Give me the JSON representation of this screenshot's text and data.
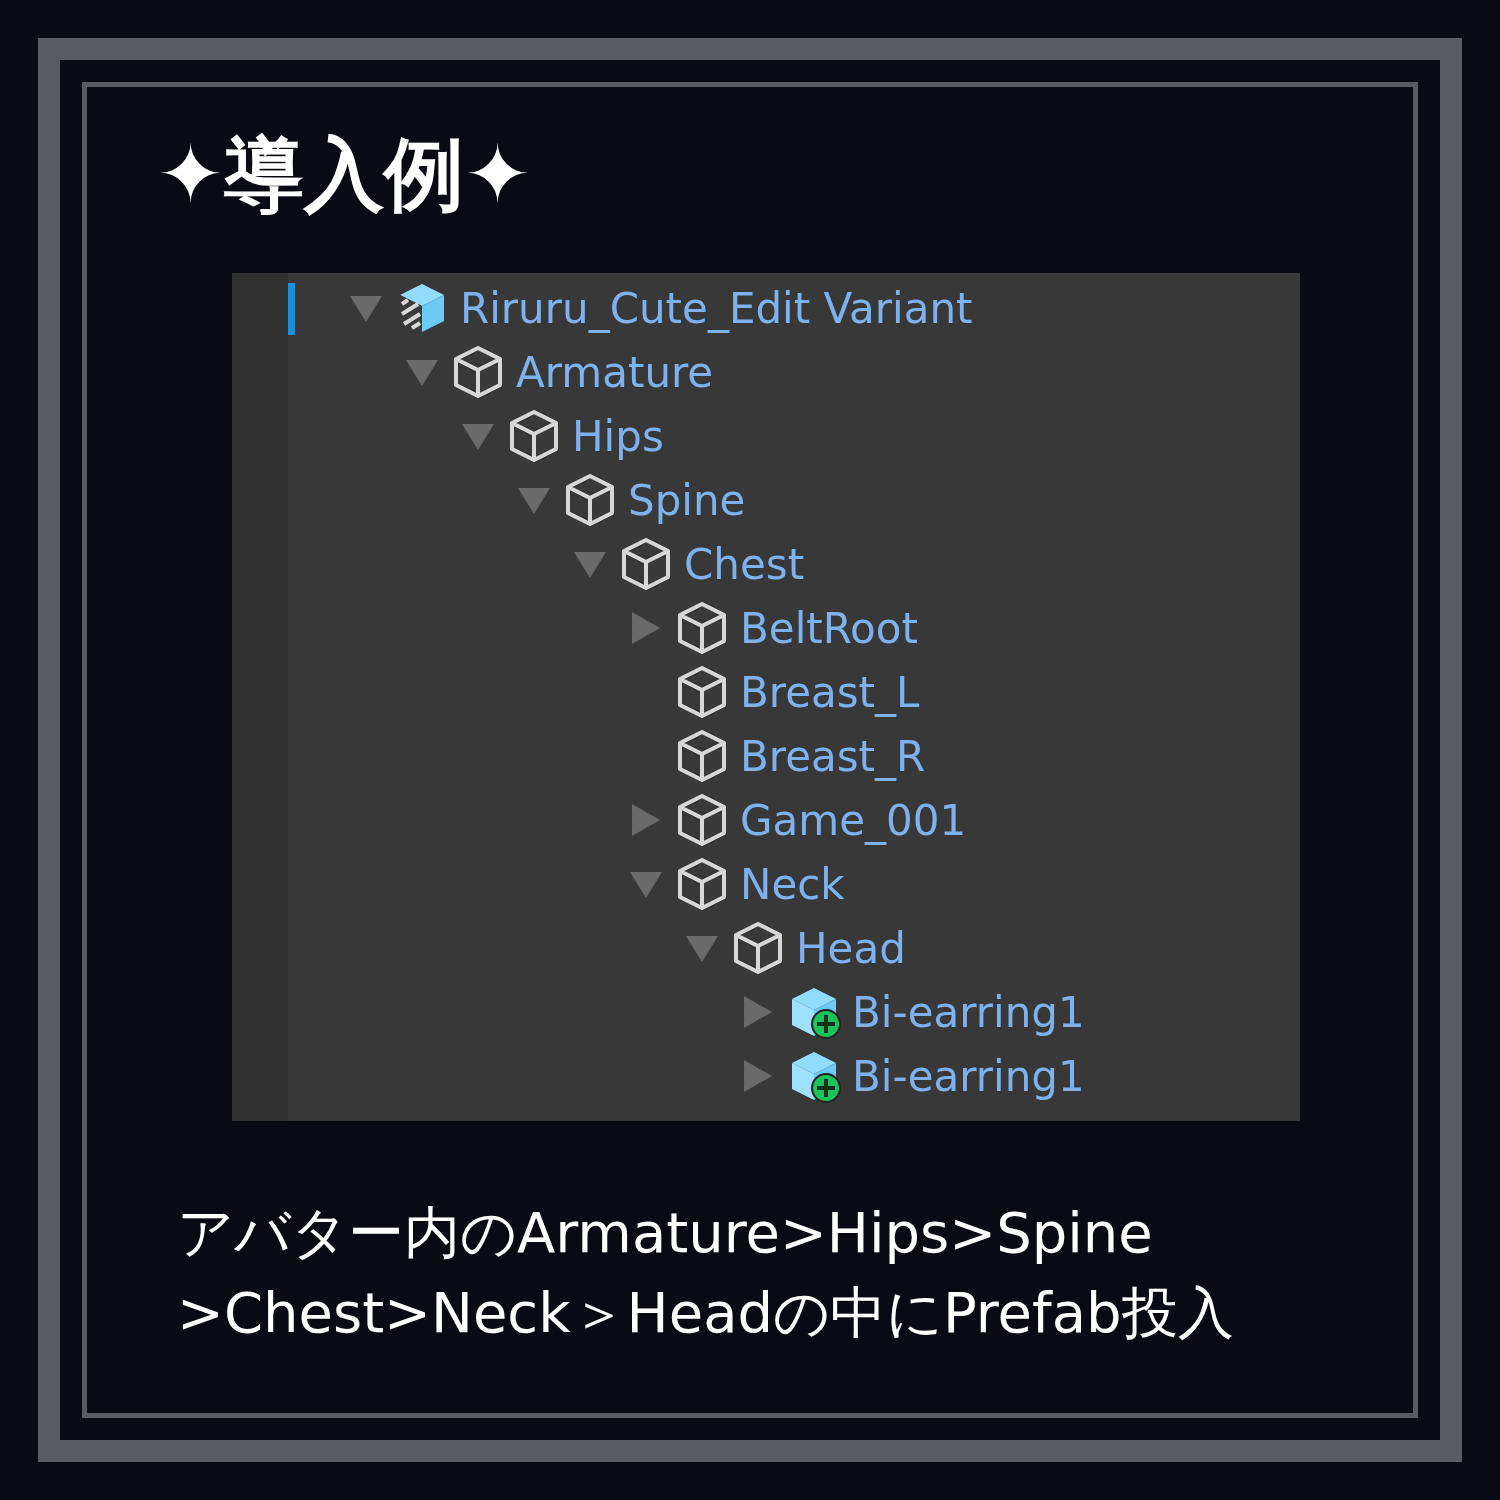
{
  "title": "✦導入例✦",
  "hierarchy": {
    "items": [
      {
        "label": "Riruru_Cute_Edit Variant",
        "kind": "prefab-root",
        "expanded": true,
        "selected": true,
        "children": [
          {
            "label": "Armature",
            "kind": "object",
            "expanded": true,
            "children": [
              {
                "label": "Hips",
                "kind": "object",
                "expanded": true,
                "children": [
                  {
                    "label": "Spine",
                    "kind": "object",
                    "expanded": true,
                    "children": [
                      {
                        "label": "Chest",
                        "kind": "object",
                        "expanded": true,
                        "children": [
                          {
                            "label": "BeltRoot",
                            "kind": "object",
                            "expanded": false
                          },
                          {
                            "label": "Breast_L",
                            "kind": "object"
                          },
                          {
                            "label": "Breast_R",
                            "kind": "object"
                          },
                          {
                            "label": "Game_001",
                            "kind": "object",
                            "expanded": false
                          },
                          {
                            "label": "Neck",
                            "kind": "object",
                            "expanded": true,
                            "children": [
                              {
                                "label": "Head",
                                "kind": "object",
                                "expanded": true,
                                "children": [
                                  {
                                    "label": "Bi-earring1",
                                    "kind": "added-prefab",
                                    "expanded": false
                                  },
                                  {
                                    "label": "Bi-earring1",
                                    "kind": "added-prefab",
                                    "expanded": false
                                  }
                                ]
                              }
                            ]
                          }
                        ]
                      }
                    ]
                  }
                ]
              }
            ]
          }
        ]
      }
    ]
  },
  "caption_lines": [
    "アバター内のArmature>Hips>Spine",
    ">Chest>Neck＞Headの中にPrefab投入"
  ]
}
